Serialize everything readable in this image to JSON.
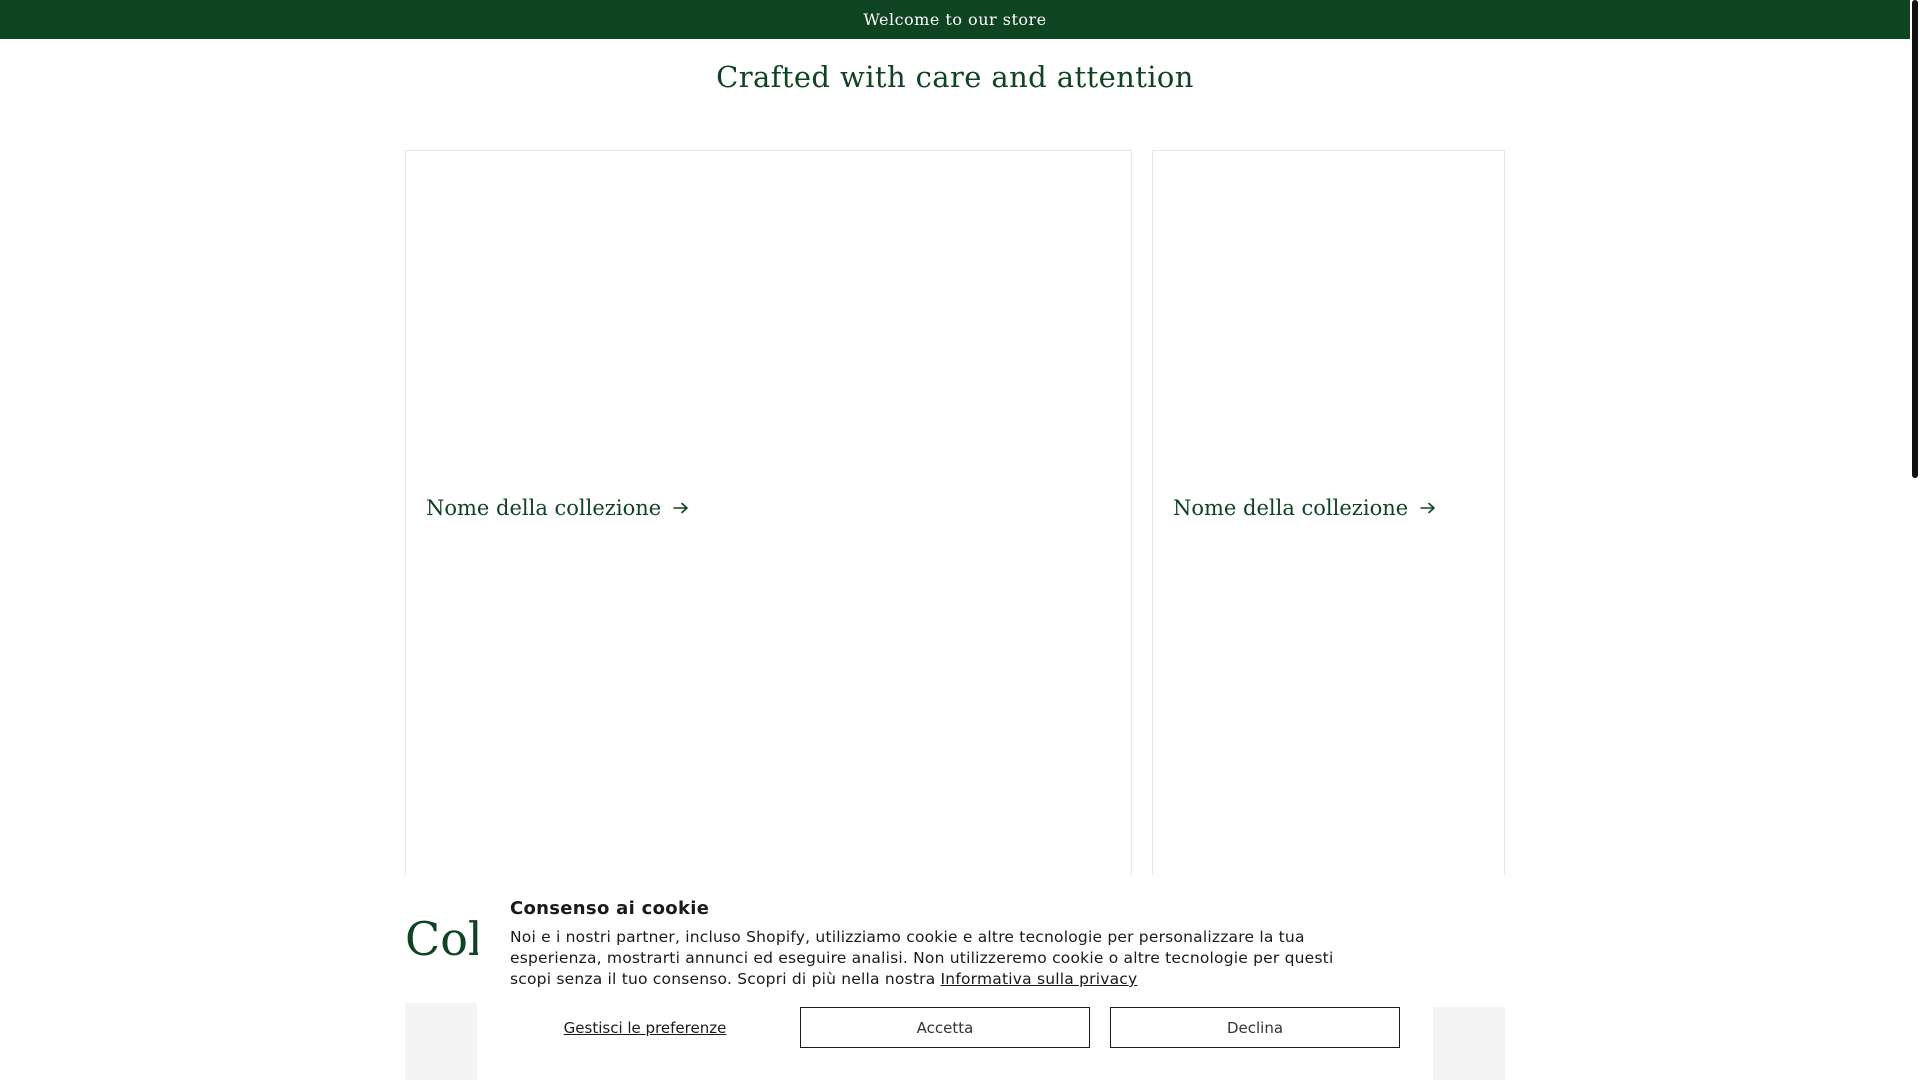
{
  "announcement": {
    "text": "Welcome to our store"
  },
  "featured": {
    "heading": "Crafted with care and attention",
    "cards": [
      {
        "label": "Nome della collezione",
        "icon": "arrow-right-icon"
      },
      {
        "label": "Nome della collezione",
        "icon": "arrow-right-icon"
      }
    ]
  },
  "collections": {
    "heading_visible": "Coll"
  },
  "cookie_banner": {
    "title": "Consenso ai cookie",
    "body": "Noi e i nostri partner, incluso Shopify, utilizziamo cookie e altre tecnologie per personalizzare la tua esperienza, mostrarti annunci ed eseguire analisi. Non utilizzeremo cookie o altre tecnologie per questi scopi senza il tuo consenso. Scopri di più nella nostra",
    "privacy_link": "Informativa sulla privacy",
    "manage_label": "Gestisci le preferenze",
    "accept_label": "Accetta",
    "decline_label": "Declina"
  },
  "colors": {
    "brand_green": "#0f4423",
    "text": "#1a1a1a",
    "border": "#e6e6e6"
  }
}
